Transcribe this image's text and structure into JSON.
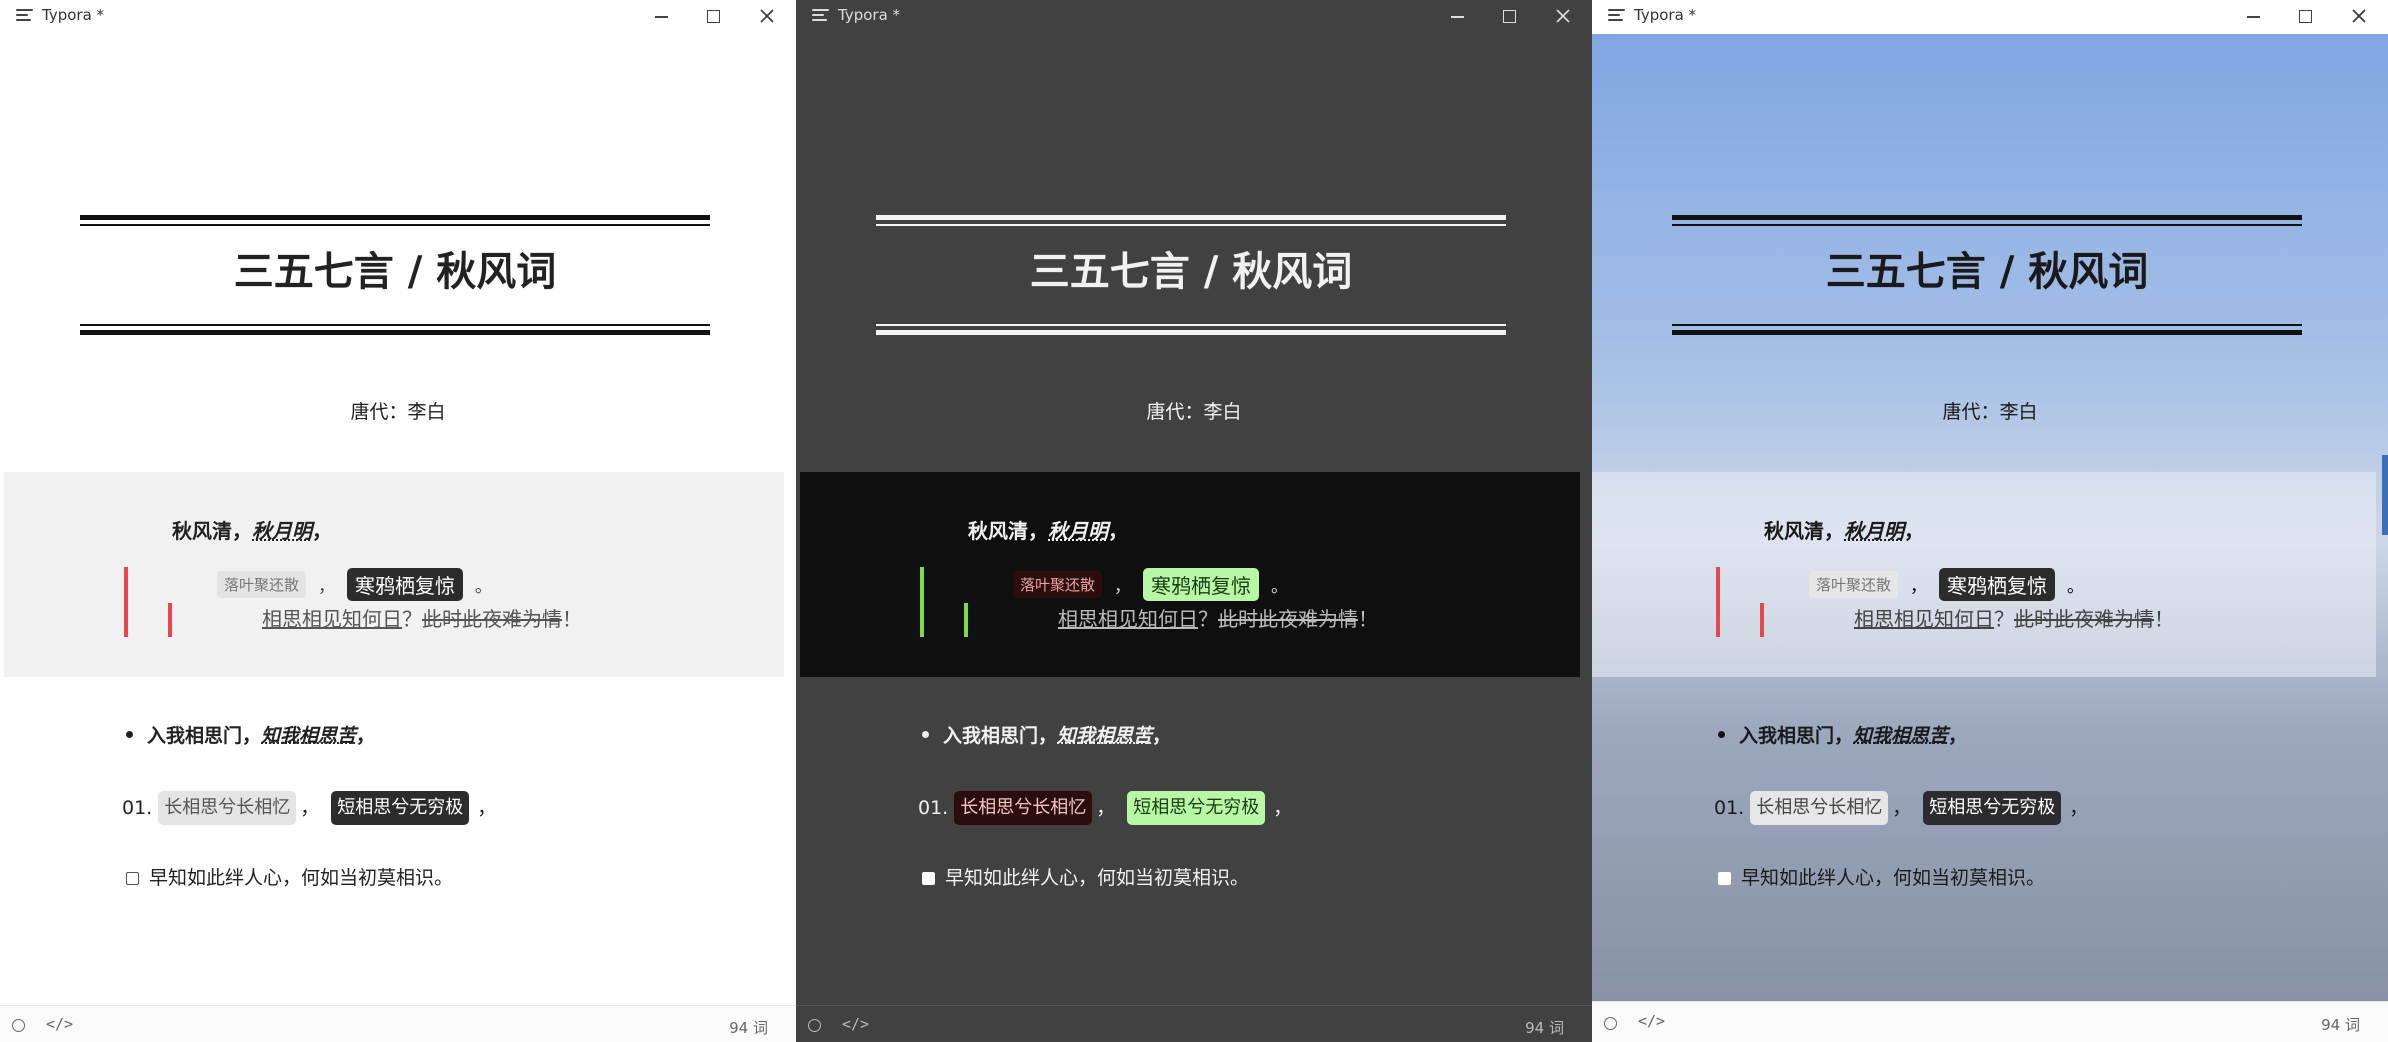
{
  "app": {
    "title": "Typora *"
  },
  "document": {
    "heading": "三五七言 / 秋风词",
    "author": "唐代：李白",
    "quote": {
      "line1_plain": "秋风清，",
      "line1_emph": "秋月明",
      "line1_end": "，",
      "chip1": "落叶聚还散",
      "chip1_sep": "，",
      "chip2": "寒鸦栖复惊",
      "chip2_end": "。",
      "line3_underline": "相思相见知何日",
      "line3_mid": "？",
      "line3_strike": "此时此夜难为情",
      "line3_end": "！"
    },
    "bullet": {
      "plain": "入我相思门，",
      "emph": "知我相思苦",
      "end": "，"
    },
    "ordered": {
      "number": "01.",
      "code1": "长相思兮长相忆",
      "sep1": "，",
      "code2": "短相思兮无穷极",
      "end": "，"
    },
    "task": {
      "text": "早知如此绊人心，何如当初莫相识。",
      "checked": false
    }
  },
  "statusbar": {
    "source_toggle": "</>",
    "word_count": "94 词"
  },
  "themes": {
    "light": {
      "background": "#ffffff",
      "quote_bg": "#f1f1f1",
      "accent": "#e7464c"
    },
    "dark": {
      "background": "#414141",
      "quote_bg": "#0f0f0f",
      "accent": "#7cdc3e",
      "highlight": "#b8f7a6"
    },
    "sky": {
      "background": "#7ea3e4",
      "quote_bg": "#ebeff5",
      "accent": "#e7464c"
    }
  },
  "icons": [
    "menu-icon",
    "minimize-icon",
    "maximize-icon",
    "close-icon",
    "status-circle-icon",
    "source-code-icon",
    "checkbox-icon"
  ]
}
